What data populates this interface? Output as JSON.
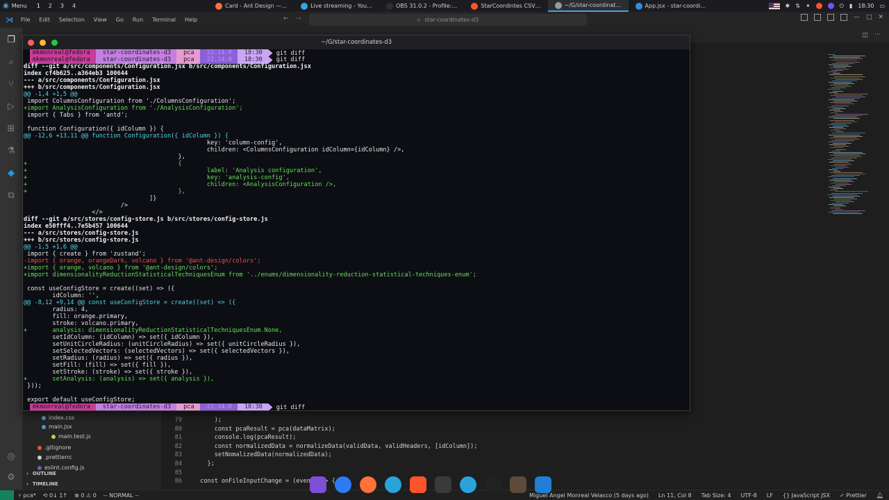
{
  "system_panel": {
    "menu_label": "Menu",
    "workspaces": [
      "1",
      "2",
      "3",
      "4"
    ],
    "tasks": [
      {
        "label": "Card - Ant Design —…",
        "icon": "firefox-icon",
        "color": "#ff7139"
      },
      {
        "label": "Live streaming - You…",
        "icon": "firefox-icon",
        "color": "#38a4e8"
      },
      {
        "label": "OBS 31.0.2 - Profile:…",
        "icon": "obs-icon",
        "color": "#302e31"
      },
      {
        "label": "StarCoordintes CSV…",
        "icon": "brave-icon",
        "color": "#fb542b"
      },
      {
        "label": "~/G/star-coordinat…",
        "icon": "terminal-icon",
        "color": "#9a9a9a"
      },
      {
        "label": "App.jsx - star-coordi…",
        "icon": "vscode-icon",
        "color": "#2f8ee0"
      }
    ],
    "clock": "18:30"
  },
  "vscode": {
    "menus": [
      "File",
      "Edit",
      "Selection",
      "View",
      "Go",
      "Run",
      "Terminal",
      "Help"
    ],
    "search_text": "star-coordinates-d3",
    "sidebar": {
      "files": [
        {
          "name": "index.css",
          "icon_color": "#519aba"
        },
        {
          "name": "main.jsx",
          "icon_color": "#519aba"
        },
        {
          "name": "main.test.js",
          "icon_color": "#cbcb41"
        },
        {
          "name": ".gitignore",
          "icon_color": "#f14e32"
        },
        {
          "name": ".prettierrc",
          "icon_color": "#cccccc"
        },
        {
          "name": "eslint.config.js",
          "icon_color": "#7e57c2"
        }
      ],
      "outline_label": "OUTLINE",
      "timeline_label": "TIMELINE"
    },
    "code_lines": [
      {
        "num": "79",
        "text": "      );"
      },
      {
        "num": "80",
        "text": "      const pcaResult = pca(dataMatrix);"
      },
      {
        "num": "81",
        "text": "      console.log(pcaResult);"
      },
      {
        "num": "82",
        "text": "      const normalizedData = normalizeData(validData, validHeaders, [idColumn]);"
      },
      {
        "num": "83",
        "text": "      setNomalizedData(normalizedData);"
      },
      {
        "num": "84",
        "text": "    };"
      },
      {
        "num": "85",
        "text": ""
      },
      {
        "num": "86",
        "text": "  const onFileInputChange = (event) => {"
      }
    ],
    "status": {
      "branch": "pca*",
      "sync": "⟲ 0↓ 1↑",
      "problems": "⊗ 0 ⚠ 0",
      "mode": "-- NORMAL --",
      "blame": "Miguel Angel Monreal Velasco (5 days ago)",
      "position": "Ln 11, Col 8",
      "tab_size": "Tab Size: 4",
      "encoding": "UTF-8",
      "eol": "LF",
      "language": "{} JavaScript JSX",
      "formatter": "✓ Prettier"
    }
  },
  "terminal": {
    "title": "~/G/star-coordinates-d3",
    "prompt": {
      "user": "mkmonreal@fedora",
      "dir": "star-coordinates-d3",
      "branch": "pca",
      "node": "22.14.0",
      "time": "18:30",
      "command": "git diff"
    },
    "lines": [
      {
        "t": "hdr",
        "s": "diff --git a/src/components/Configuration.jsx b/src/components/Configuration.jsx"
      },
      {
        "t": "hdr",
        "s": "index cf4b625..a364eb3 100644"
      },
      {
        "t": "hdr",
        "s": "--- a/src/components/Configuration.jsx"
      },
      {
        "t": "hdr",
        "s": "+++ b/src/components/Configuration.jsx"
      },
      {
        "t": "hunk",
        "s": "@@ -1,4 +1,5 @@"
      },
      {
        "t": "ctx",
        "s": " import ColumnsConfiguration from './ColumnsConfiguration';"
      },
      {
        "t": "add",
        "s": "+import AnalysisConfiguration from './AnalysisConfiguration';"
      },
      {
        "t": "ctx",
        "s": " import { Tabs } from 'antd';"
      },
      {
        "t": "ctx",
        "s": " "
      },
      {
        "t": "ctx",
        "s": " function Configuration({ idColumn }) {"
      },
      {
        "t": "hunk",
        "s": "@@ -12,6 +13,11 @@ function Configuration({ idColumn }) {"
      },
      {
        "t": "ctx",
        "s": "                                                   key: 'column-config',"
      },
      {
        "t": "ctx",
        "s": "                                                   children: <ColumnsConfiguration idColumn={idColumn} />,"
      },
      {
        "t": "ctx",
        "s": "                                           },"
      },
      {
        "t": "add",
        "s": "+                                          {"
      },
      {
        "t": "add",
        "s": "+                                                  label: 'Analysis configuration',"
      },
      {
        "t": "add",
        "s": "+                                                  key: 'analysis-config',"
      },
      {
        "t": "add",
        "s": "+                                                  children: <AnalysisConfiguration />,"
      },
      {
        "t": "add",
        "s": "+                                          },"
      },
      {
        "t": "ctx",
        "s": "                                   ]}"
      },
      {
        "t": "ctx",
        "s": "                           />"
      },
      {
        "t": "ctx",
        "s": "                   </>"
      },
      {
        "t": "hdr",
        "s": "diff --git a/src/stores/config-store.js b/src/stores/config-store.js"
      },
      {
        "t": "hdr",
        "s": "index e50fff4..7e5b457 100644"
      },
      {
        "t": "hdr",
        "s": "--- a/src/stores/config-store.js"
      },
      {
        "t": "hdr",
        "s": "+++ b/src/stores/config-store.js"
      },
      {
        "t": "hunk",
        "s": "@@ -1,5 +1,6 @@"
      },
      {
        "t": "ctx",
        "s": " import { create } from 'zustand';"
      },
      {
        "t": "del",
        "s": "-import { orange, orangeDark, volcano } from '@ant-design/colors';"
      },
      {
        "t": "add",
        "s": "+import { orange, volcano } from '@ant-design/colors';"
      },
      {
        "t": "add",
        "s": "+import dimensionalityReductionStatisticalTechniquesEnum from '../enums/dimensionality-reduction-statistical-techniques-enum';"
      },
      {
        "t": "ctx",
        "s": " "
      },
      {
        "t": "ctx",
        "s": " const useConfigStore = create((set) => ({"
      },
      {
        "t": "ctx",
        "s": "        idColumn: '',"
      },
      {
        "t": "hunk",
        "s": "@@ -8,12 +9,14 @@ const useConfigStore = create((set) => ({"
      },
      {
        "t": "ctx",
        "s": "        radius: 4,"
      },
      {
        "t": "ctx",
        "s": "        fill: orange.primary,"
      },
      {
        "t": "ctx",
        "s": "        stroke: volcano.primary,"
      },
      {
        "t": "add",
        "s": "+       analysis: dimensionalityReductionStatisticalTechniquesEnum.None,"
      },
      {
        "t": "ctx",
        "s": "        setIdColumn: (idColumn) => set({ idColumn }),"
      },
      {
        "t": "ctx",
        "s": "        setUnitCircleRadius: (unitCircleRadius) => set({ unitCircleRadius }),"
      },
      {
        "t": "ctx",
        "s": "        setSelectedVectors: (selectedVectors) => set({ selectedVectors }),"
      },
      {
        "t": "ctx",
        "s": "        setRadius: (radius) => set({ radius }),"
      },
      {
        "t": "ctx",
        "s": "        setFill: (fill) => set({ fill }),"
      },
      {
        "t": "ctx",
        "s": "        setStroke: (stroke) => set({ stroke }),"
      },
      {
        "t": "add",
        "s": "+       setAnalysis: (analysis) => set({ analysis }),"
      },
      {
        "t": "ctx",
        "s": " }));"
      },
      {
        "t": "ctx",
        "s": " "
      },
      {
        "t": "ctx",
        "s": " export default useConfigStore;"
      }
    ]
  }
}
